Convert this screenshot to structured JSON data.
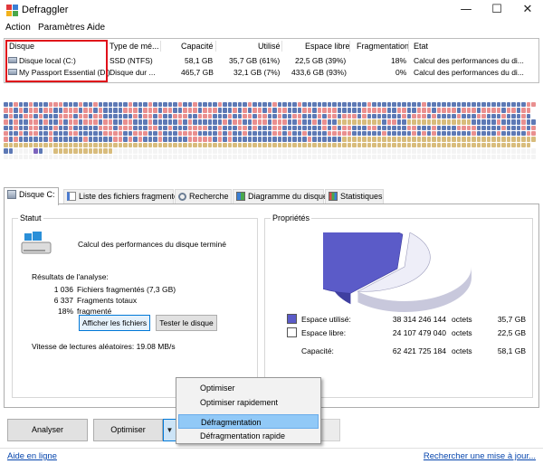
{
  "window": {
    "title": "Defraggler",
    "minimize": "—",
    "maximize": "☐",
    "close": "✕"
  },
  "menu": [
    "Action",
    "Paramètres",
    "Aide"
  ],
  "drive_table": {
    "columns": [
      "Disque",
      "Type de mé...",
      "Capacité",
      "Utilisé",
      "Espace libre",
      "Fragmentation",
      "Etat"
    ],
    "rows": [
      {
        "disk": "Disque local (C:)",
        "type": "SSD (NTFS)",
        "capacity": "58,1 GB",
        "used": "35,7 GB (61%)",
        "free": "22,5 GB (39%)",
        "frag": "18%",
        "state": "Calcul des performances du di..."
      },
      {
        "disk": "My Passport Essential (D:)",
        "type": "Disque dur ...",
        "capacity": "465,7 GB",
        "used": "32,1 GB (7%)",
        "free": "433,6 GB (93%)",
        "frag": "0%",
        "state": "Calcul des performances du di..."
      }
    ]
  },
  "block_map": {
    "colors": {
      "blue": "#5d79b5",
      "red": "#e98f8f",
      "yellow": "#d8bc7c",
      "white": "#f4f4f4",
      "purple": "#7c63bd",
      "empty": "#ffffff"
    },
    "rows": [
      "bbrbbrbbbrrrbbbrbbrbbbbbbrbbbrbbbbbrbbrbbbbrbbbbbrbbbbrbbbbrbbbbbbbbbbbbbrbbbbbbbbbbrbbbbbbbbbbbbbbbbbbbbrr",
      "rrbrbrrbrrbbrrrbrrbrbbbbrrrbrrrbrrbbrrrbrrrbbbrbrbrrbrbrrbbbrrbrrrrbbbbbrrrrrbbrrbbrrrbrrrrbrrrbrrrrbrrbrr",
      "brbbrrbrbbbrrrbrrbrrbbbbbbrbrrbrbbrrrbbrrrbbbrbbrrbrrbbrbbrrbbbrbrrbrrrbrbbbbbbbrbrrrbrbbbbrbbbrrbbbrbbbrb",
      "rbrbbrrbrbbrbrrbrrrbrrbbrrbbbrbbbbbrbrbbbbbbrbrrbbrrrbrrrbbrbbrbrbbyyyyyyyyybrrbbyyyyyyyyyyyyybbbbbrbbbbrbb",
      "bbrbbrrbbbrbbrbbbbbrrrbrrrbbbrrbbrbbbrrrrbbrbbbrrbrbbbrrbbbbbbbbrbrbrrbbbrrbbbbbbrrbbbrbbbbrrrrbbbbbrbbbrbr",
      "rbbrbrrbbrbbbrrbbbbbrrrrbbrrrbbrbbbrrrrbbbbrbrbbrbbbbbrrbrbbrbbbbrrrrrbbbbbbrbbbbbrbrbrbbbbbbbrbbbbrbbbbbrr",
      "rbrbbbbbbrbbbbbbrbbbbbrrbrbrbbbrbbbbbrrrrrbrbrbbbbbbbbbbbbbbbrbbbbbbyyyyyyyyyyyyyyyyyyyyyyyyyyyyyyyyyyyyyyy",
      "yyyyyyyyyyyyyyyyyyyyyyyyyyyyyyyyyyyyyyyyyyyyyyyyyyyyyyyyyyyyyyyyyyyyyyyyyyyyyyyyyyyyyyyyyyyyyyyyyyyyyyyyyy",
      "bbwwwwpbwwyyyyyyyyyyyywwwwwwwwwwwwwwwwwwwwwwwwwwwwwwwwwwwwwwwwwwwwwwwwwwwwwwwwwwwwwwwwwwwwwwwwwwwwwwwwwwwww",
      "wwwwwwwwwwwwwwwwwwwwwwwwwwwwwwwwwwwwwwwwwwwwwwwwwwwwwwwwwwwwwwwwwwwwwwwwwwwwwwwwwwwwwwwwwwwwwwwwwwwwwwwwwww"
    ]
  },
  "tabs": [
    {
      "label": "Disque C:",
      "icon": "disk-icon"
    },
    {
      "label": "Liste des fichiers fragmentés",
      "icon": "file-list-icon"
    },
    {
      "label": "Recherche",
      "icon": "search-icon"
    },
    {
      "label": "Diagramme du disque",
      "icon": "disk-map-icon"
    },
    {
      "label": "Statistiques",
      "icon": "statistics-icon"
    }
  ],
  "status": {
    "title": "Statut",
    "message": "Calcul des performances du disque terminé",
    "results_label": "Résultats de l'analyse:",
    "results": [
      {
        "value": "1 036",
        "label": "Fichiers fragmentés (7,3 GB)"
      },
      {
        "value": "6 337",
        "label": "Fragments totaux"
      },
      {
        "value": "18%",
        "label": "fragmenté"
      }
    ],
    "show_files_button": "Afficher les fichiers",
    "test_disk_button": "Tester le disque",
    "random_read": "Vitesse de lectures aléatoires: 19.08 MB/s"
  },
  "properties": {
    "title": "Propriétés",
    "used_fraction": 0.61,
    "used_color": "#5b5bc8",
    "free_color": "#eeeef8",
    "rows": [
      {
        "label": "Espace utilisé:",
        "bytes": "38 314 246 144",
        "unit": "octets",
        "size": "35,7 GB",
        "swatch": "used"
      },
      {
        "label": "Espace libre:",
        "bytes": "24 107 479 040",
        "unit": "octets",
        "size": "22,5 GB",
        "swatch": "free"
      },
      {
        "label": "Capacité:",
        "bytes": "62 421 725 184",
        "unit": "octets",
        "size": "58,1 GB",
        "swatch": "none"
      }
    ]
  },
  "bottom": {
    "analyze": "Analyser",
    "optimize": "Optimiser",
    "dropdown": "▼"
  },
  "popup_menu": {
    "items": [
      "Optimiser",
      "Optimiser rapidement",
      "Défragmentation",
      "Défragmentation rapide"
    ],
    "selected": 2
  },
  "statusbar": {
    "help": "Aide en ligne",
    "update": "Rechercher une mise à jour..."
  }
}
